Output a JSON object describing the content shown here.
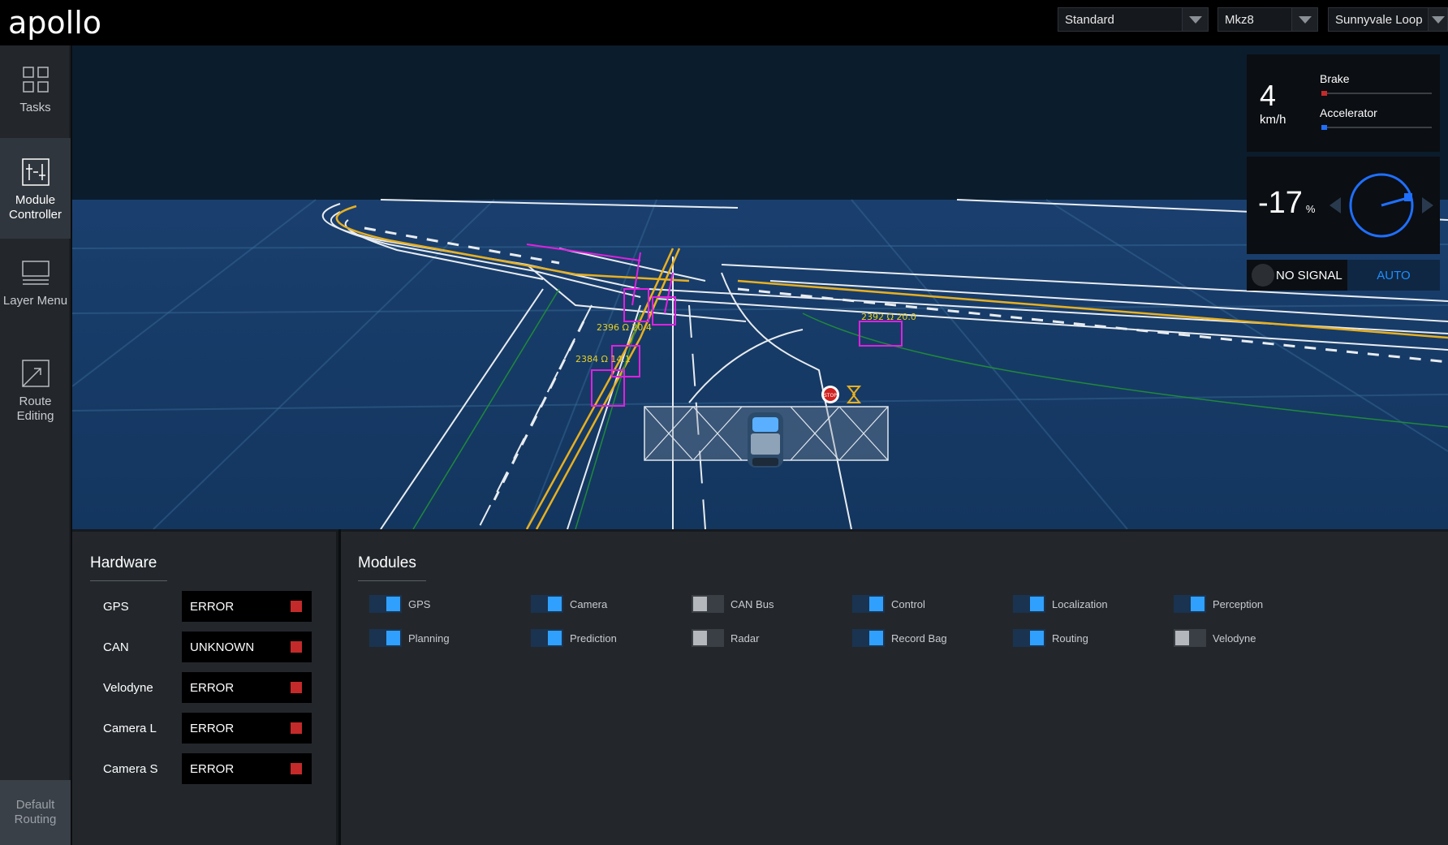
{
  "header": {
    "logo_text": "apollo",
    "mode_select": {
      "value": "Standard"
    },
    "vehicle_select": {
      "value": "Mkz8"
    },
    "map_select": {
      "value": "Sunnyvale Loop"
    }
  },
  "sidebar": {
    "items": [
      {
        "label": "Tasks",
        "icon": "grid-icon",
        "active": false
      },
      {
        "label": "Module Controller",
        "icon": "sliders-icon",
        "active": true
      },
      {
        "label": "Layer Menu",
        "icon": "layers-icon",
        "active": false
      },
      {
        "label": "Route Editing",
        "icon": "route-edit-icon",
        "active": false
      }
    ],
    "bottom_label": "Default Routing"
  },
  "dashboard": {
    "speed": "4",
    "speed_unit": "km/h",
    "brake_label": "Brake",
    "brake_level": 0.05,
    "brake_color": "#c52a2a",
    "accelerator_label": "Accelerator",
    "accelerator_level": 0.05,
    "accelerator_color": "#1f6fff",
    "steering": "-17",
    "steering_unit": "%",
    "signal_text": "NO SIGNAL",
    "drive_mode": "AUTO"
  },
  "scene": {
    "obstacle_labels": [
      "2396 Ω 20.4",
      "2384 Ω 14.1",
      "2392 Ω 20.0"
    ],
    "stop_sign_text": "STOP"
  },
  "hardware": {
    "title": "Hardware",
    "items": [
      {
        "name": "GPS",
        "status": "ERROR"
      },
      {
        "name": "CAN",
        "status": "UNKNOWN"
      },
      {
        "name": "Velodyne",
        "status": "ERROR"
      },
      {
        "name": "Camera L",
        "status": "ERROR"
      },
      {
        "name": "Camera S",
        "status": "ERROR"
      }
    ]
  },
  "modules": {
    "title": "Modules",
    "items": [
      {
        "label": "GPS",
        "enabled": true
      },
      {
        "label": "Camera",
        "enabled": true
      },
      {
        "label": "CAN Bus",
        "enabled": false
      },
      {
        "label": "Control",
        "enabled": true
      },
      {
        "label": "Localization",
        "enabled": true
      },
      {
        "label": "Perception",
        "enabled": true
      },
      {
        "label": "Planning",
        "enabled": true
      },
      {
        "label": "Prediction",
        "enabled": true
      },
      {
        "label": "Radar",
        "enabled": false
      },
      {
        "label": "Record Bag",
        "enabled": true
      },
      {
        "label": "Routing",
        "enabled": true
      },
      {
        "label": "Velodyne",
        "enabled": false
      }
    ]
  },
  "colors": {
    "accent": "#30a0ff",
    "error": "#c52a2a",
    "obstacle": "#e020e0",
    "lane_yellow": "#e8b020"
  }
}
